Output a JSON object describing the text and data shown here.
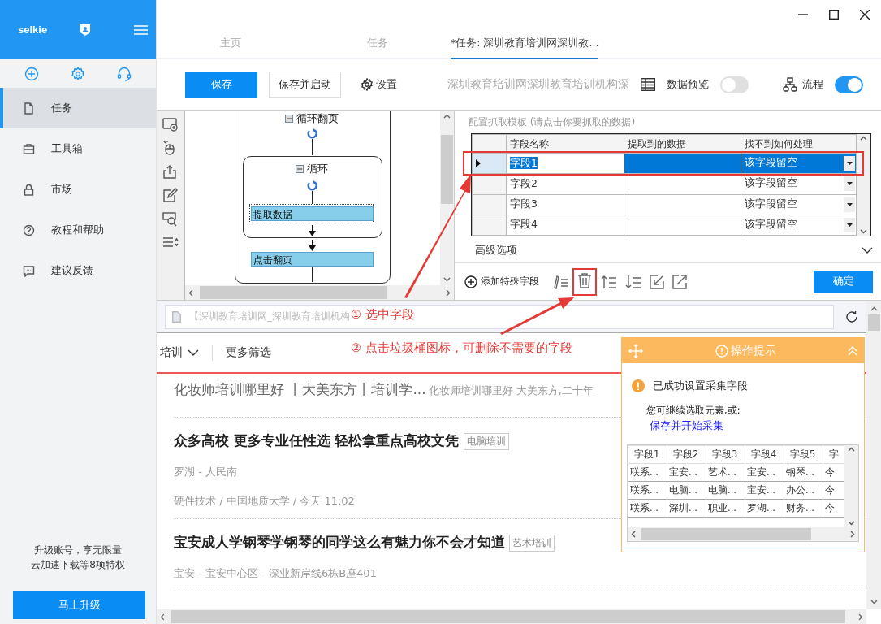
{
  "sidebar": {
    "brand": "selkie",
    "items": [
      {
        "label": "任务",
        "selected": true
      },
      {
        "label": "工具箱",
        "selected": false
      },
      {
        "label": "市场",
        "selected": false
      },
      {
        "label": "教程和帮助",
        "selected": false
      },
      {
        "label": "建议反馈",
        "selected": false
      }
    ],
    "promo": [
      "升级账号，享无限量",
      "云加速下载等8项特权"
    ],
    "upgrade_button": "马上升级"
  },
  "tabs": [
    {
      "label": "主页",
      "selected": false
    },
    {
      "label": "任务",
      "selected": false
    },
    {
      "label": "*任务: 深圳教育培训网深圳教...",
      "selected": true
    }
  ],
  "toolbar": {
    "save": "保存",
    "save_and_start": "保存并启动",
    "settings": "设置",
    "task_title": "深圳教育培训网深圳教育培训机构深",
    "data_preview": {
      "label": "数据预览",
      "on": false
    },
    "flow": {
      "label": "流程",
      "on": true
    }
  },
  "flowchart": {
    "outer_loop": "循环翻页",
    "inner_loop": "循环",
    "extract_step": "提取数据",
    "click_step": "点击翻页"
  },
  "template": {
    "title": "配置抓取模板 (请点击你要抓取的数据)",
    "columns": [
      "字段名称",
      "提取到的数据",
      "找不到如何处理"
    ],
    "rows": [
      {
        "name": "字段1",
        "handling": "该字段留空",
        "selected": true
      },
      {
        "name": "字段2",
        "handling": "该字段留空",
        "selected": false
      },
      {
        "name": "字段3",
        "handling": "该字段留空",
        "selected": false
      },
      {
        "name": "字段4",
        "handling": "该字段留空",
        "selected": false
      }
    ],
    "advanced": "高级选项",
    "add_field": "添加特殊字段",
    "confirm": "确定"
  },
  "browser": {
    "url": "【深圳教育培训网_深圳教育培训机构",
    "filter": {
      "category": "培训",
      "more": "更多筛选"
    },
    "listings": [
      {
        "kind": "summary",
        "title": "化妆师培训哪里好 丨大美东方丨培训学...",
        "description": "化妆师培训哪里好 大美东方,二十年"
      },
      {
        "kind": "course",
        "title": "众多高校 更多专业任性选 轻松拿重点高校文凭",
        "tag": "电脑培训",
        "lines": [
          "罗湖 - 人民南",
          "硬件技术 / 中国地质大学 / 今天 11:02"
        ]
      },
      {
        "kind": "course",
        "title": "宝安成人学钢琴学钢琴的同学这么有魅力你不会才知道",
        "tag": "艺术培训",
        "lines": [
          "宝安 - 宝安中心区 - 深业新岸线6栋B座401"
        ]
      }
    ]
  },
  "annotations": [
    "① 选中字段",
    "② 点击垃圾桶图标，可删除不需要的字段"
  ],
  "tip_popup": {
    "title": "操作提示",
    "message": "已成功设置采集字段",
    "hint": "您可继续选取元素,或:",
    "link": "保存并开始采集",
    "columns": [
      "字段1",
      "字段2",
      "字段3",
      "字段4",
      "字段5",
      "字"
    ],
    "rows": [
      [
        "联系...",
        "宝安...",
        "艺术...",
        "宝安...",
        "钢琴...",
        "今"
      ],
      [
        "联系...",
        "电脑...",
        "电脑...",
        "宝安...",
        "办公...",
        "今"
      ],
      [
        "联系...",
        "深圳...",
        "职业...",
        "罗湖...",
        "财务...",
        "今"
      ]
    ]
  }
}
